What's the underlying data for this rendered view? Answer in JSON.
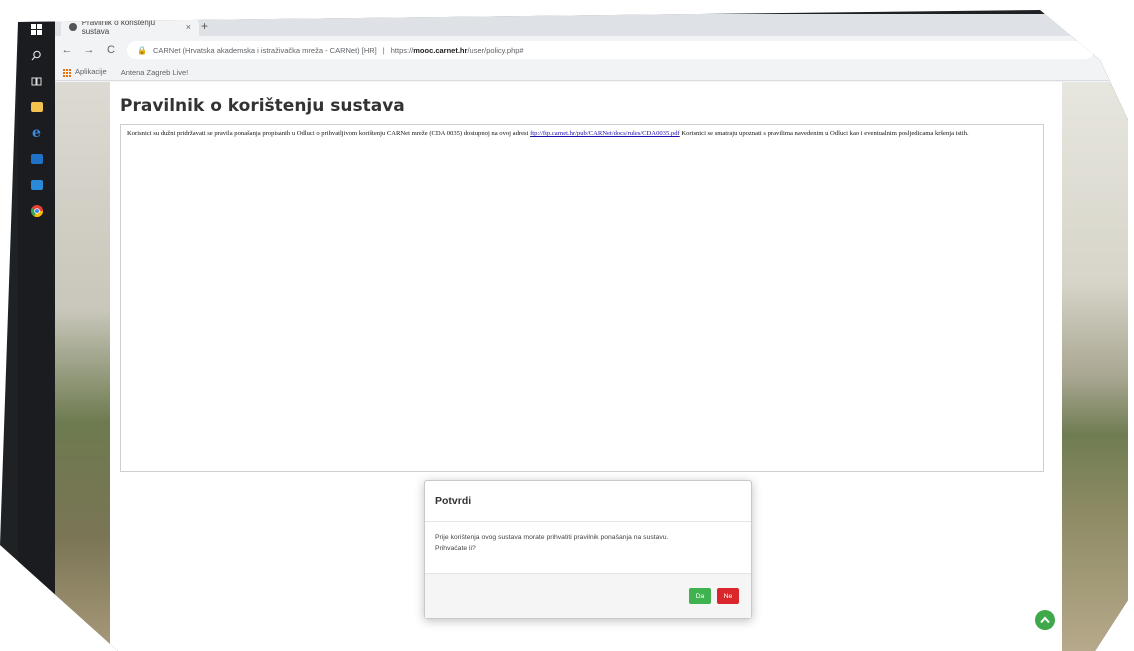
{
  "browser": {
    "tab_title": "Pravilnik o korištenju sustava",
    "tab_close": "×",
    "new_tab": "+",
    "back": "←",
    "forward": "→",
    "reload": "C",
    "lock": "🔒",
    "url_site_info": "CARNet (Hrvatska akademska i istraživačka mreža - CARNet) [HR]",
    "url_sep": "|",
    "url_scheme": "https://",
    "url_host": "mooc.carnet.hr",
    "url_path": "/user/policy.php#",
    "bookmarks": [
      {
        "label": "Aplikacije"
      },
      {
        "label": "Antena Zagreb Live!"
      }
    ]
  },
  "page": {
    "title": "Pravilnik o korištenju sustava",
    "policy_text_1": "Korisnici su dužni pridržavati se pravila ponašanja propisanih u Odluci o prihvatljivom korištenju CARNet mreže (CDA 0035) dostupnoj na ovoj adresi",
    "policy_link": "ftp://ftp.carnet.hr/pub/CARNet/docs/rules/CDA0035.pdf",
    "policy_text_2": "Korisnici se smatraju upoznati s pravilima navedenim u Odluci kao i eventualnim posljedicama kršenja istih."
  },
  "modal": {
    "title": "Potvrdi",
    "body_line1": "Prije korištenja ovog sustava morate prihvatiti pravilnik ponašanja na sustavu.",
    "body_line2": "Prihvaćate li?",
    "yes_label": "Da",
    "no_label": "Ne"
  },
  "scroll_top_icon": "chevron-up",
  "colors": {
    "yes": "#3fb34f",
    "no": "#d9262b",
    "scroll_top": "#3fa84b",
    "link": "#1a0dab"
  }
}
